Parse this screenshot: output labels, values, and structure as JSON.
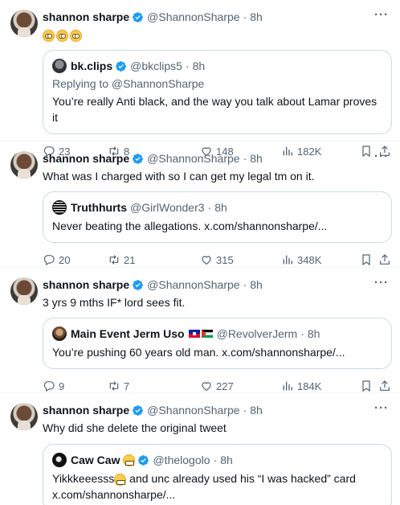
{
  "tweets": [
    {
      "name": "shannon sharpe",
      "handle": "@ShannonSharpe",
      "time": "8h",
      "text": "",
      "emoji": [
        "rolling-eyes",
        "rolling-eyes",
        "rolling-eyes"
      ],
      "quote": {
        "name": "bk.clips",
        "handle": "@bkclips5",
        "time": "8h",
        "verified": true,
        "reply_to": "Replying to @ShannonSharpe",
        "text": "You’re really Anti black, and the way you talk about Lamar proves it"
      },
      "stats": {
        "replies": "23",
        "retweets": "8",
        "likes": "148",
        "views": "182K"
      }
    },
    {
      "name": "shannon sharpe",
      "handle": "@ShannonSharpe",
      "time": "8h",
      "text": "What was I charged with so I can get my legal tm on it.",
      "quote": {
        "name": "Truthhurts",
        "handle": "@GirlWonder3",
        "time": "8h",
        "verified": false,
        "text": "Never beating the allegations. x.com/shannonsharpe/..."
      },
      "stats": {
        "replies": "20",
        "retweets": "21",
        "likes": "315",
        "views": "348K"
      }
    },
    {
      "name": "shannon sharpe",
      "handle": "@ShannonSharpe",
      "time": "8h",
      "text": "3 yrs 9 mths IF* lord sees fit.",
      "quote": {
        "name": "Main Event Jerm Uso",
        "handle": "@RevolverJerm",
        "time": "8h",
        "verified": false,
        "flags": [
          "haiti-flag",
          "palestine-flag"
        ],
        "text": "You’re pushing 60 years old man. x.com/shannonsharpe/..."
      },
      "stats": {
        "replies": "9",
        "retweets": "7",
        "likes": "227",
        "views": "184K"
      }
    },
    {
      "name": "shannon sharpe",
      "handle": "@ShannonSharpe",
      "time": "8h",
      "text": "Why did she delete the original tweet",
      "quote": {
        "name": "Caw Caw",
        "handle": "@thelogolo",
        "time": "8h",
        "verified": true,
        "text_before": "Yikkkeeesss",
        "text_after": " and unc already used his “I was hacked” card",
        "text_line2": "x.com/shannonsharpe/..."
      }
    }
  ],
  "colors": {
    "verified": "#1d9bf0",
    "muted": "#536471",
    "border": "#cfd9de"
  },
  "separator": "·"
}
